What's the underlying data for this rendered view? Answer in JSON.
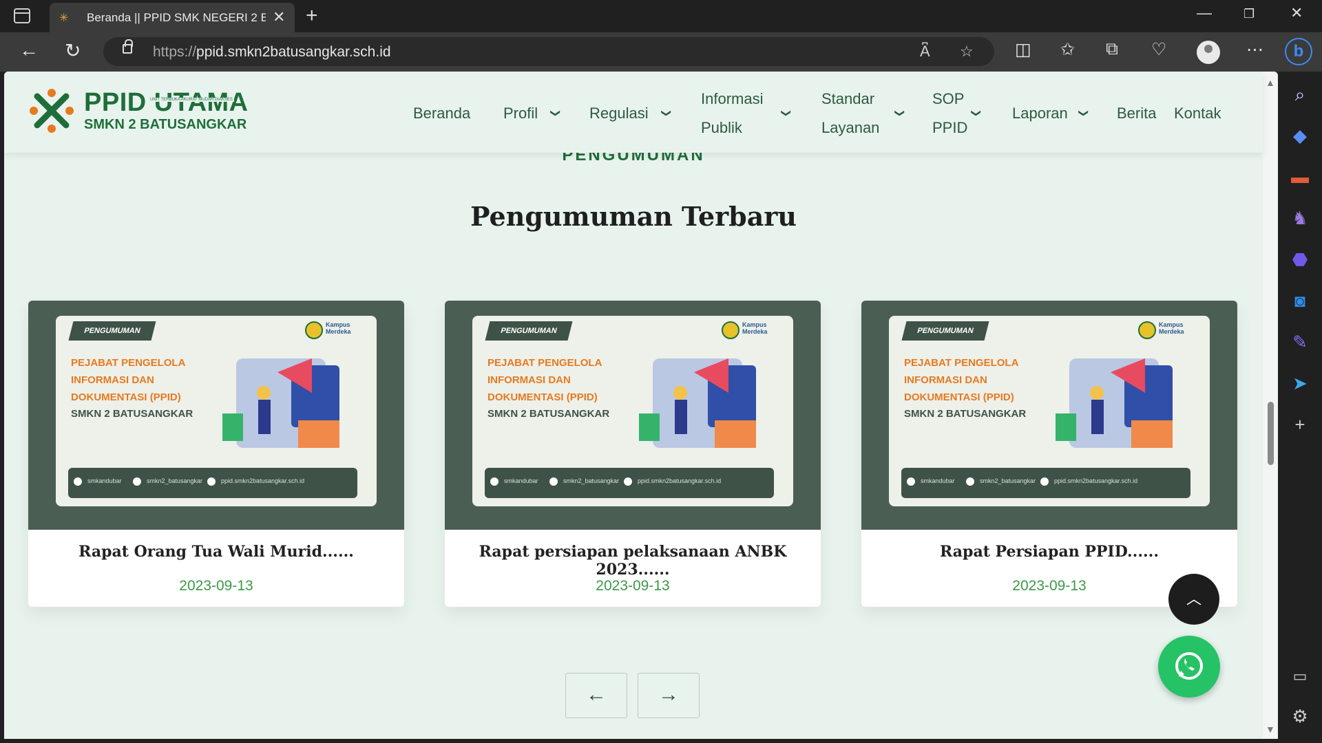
{
  "browser": {
    "tab_title": "Beranda || PPID SMK NEGERI 2 Batusangkar",
    "url_proto": "https://",
    "url_host": "ppid.smkn2batusangkar.sch.id"
  },
  "site": {
    "logo_title": "PPID UTAMA",
    "logo_tagline": "UNIT TERBUKA AKURAT MUDAH DIAKSES",
    "logo_subtitle": "SMKN 2 BATUSANGKAR",
    "menu": {
      "beranda": "Beranda",
      "profil": "Profil",
      "regulasi": "Regulasi",
      "informasi_1": "Informasi",
      "informasi_2": "Publik",
      "standar_1": "Standar",
      "standar_2": "Layanan",
      "sop_1": "SOP",
      "sop_2": "PPID",
      "laporan": "Laporan",
      "berita": "Berita",
      "kontak": "Kontak"
    }
  },
  "section": {
    "kicker": "PENGUMUMAN",
    "title": "Pengumuman Terbaru"
  },
  "poster": {
    "badge": "PENGUMUMAN",
    "line1": "PEJABAT PENGELOLA",
    "line2": "INFORMASI DAN",
    "line3": "DOKUMENTASI (PPID)",
    "school": "SMKN 2 BATUSANGKAR",
    "kampus": "Kampus",
    "merdeka": "Merdeka",
    "fb": "smkandubar",
    "ig": "smkn2_batusangkar",
    "web": "ppid.smkn2batusangkar.sch.id"
  },
  "cards": [
    {
      "title": "Rapat Orang Tua Wali Murid......",
      "date": "2023-09-13"
    },
    {
      "title": "Rapat persiapan pelaksanaan ANBK 2023......",
      "date": "2023-09-13"
    },
    {
      "title": "Rapat Persiapan PPID......",
      "date": "2023-09-13"
    }
  ],
  "pager": {
    "prev": "←",
    "next": "→"
  },
  "icons": {
    "back": "back-arrow-icon",
    "refresh": "refresh-icon",
    "lock": "lock-icon",
    "read_aloud": "read-aloud-icon",
    "favorite": "star-icon",
    "split": "split-screen-icon",
    "favorites": "favorites-icon",
    "collections": "collections-icon",
    "health": "browser-essentials-icon",
    "more": "more-icon",
    "whatsapp": "whatsapp-icon",
    "to_top": "chevron-up-icon"
  },
  "colors": {
    "brand_green": "#1f6e3a",
    "page_bg": "#e8f3ee",
    "date_green": "#3a9a45",
    "whatsapp": "#26c266"
  }
}
